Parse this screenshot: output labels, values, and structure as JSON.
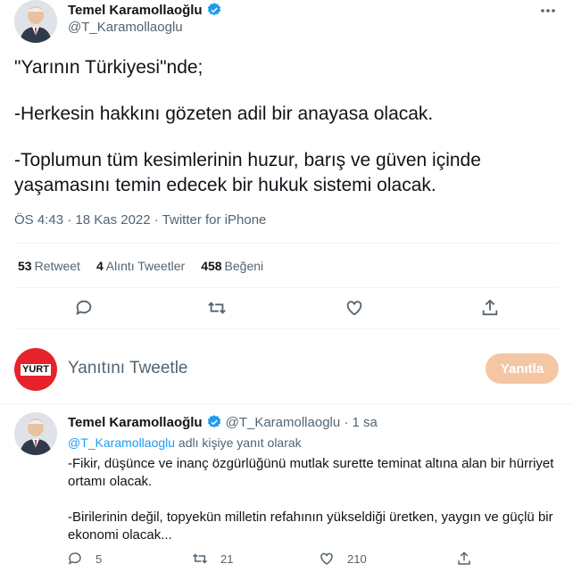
{
  "tweet": {
    "author_name": "Temel Karamollaoğlu",
    "author_handle": "@T_Karamollaoglu",
    "lines": [
      "\"Yarının Türkiyesi\"nde;",
      "-Herkesin hakkını gözeten adil bir anayasa olacak.",
      "-Toplumun tüm kesimlerinin huzur, barış ve güven içinde yaşamasını temin edecek bir hukuk sistemi olacak."
    ],
    "meta": "ÖS 4:43 · 18 Kas 2022 · Twitter for iPhone",
    "stats": {
      "retweets_count": "53",
      "retweets_label": "Retweet",
      "quotes_count": "4",
      "quotes_label": "Alıntı Tweetler",
      "likes_count": "458",
      "likes_label": "Beğeni"
    },
    "icons": [
      "reply-icon",
      "retweet-icon",
      "like-icon",
      "share-icon"
    ]
  },
  "composer": {
    "avatar_text": "YURT",
    "placeholder": "Yanıtını Tweetle",
    "button_label": "Yanıtla"
  },
  "reply": {
    "author_name": "Temel Karamollaoğlu",
    "handle_time": "@T_Karamollaoglu · 1 sa",
    "mention": "@T_Karamollaoglu",
    "reply_to_suffix": " adlı kişiye yanıt olarak",
    "paragraphs": [
      "-Fikir, düşünce ve inanç özgürlüğünü mutlak surette teminat altına alan bir hürriyet ortamı olacak.",
      "-Birilerinin değil, topyekün milletin refahının yükseldiği üretken, yaygın ve güçlü bir ekonomi olacak..."
    ],
    "actions": {
      "replies": "5",
      "retweets": "21",
      "likes": "210"
    }
  },
  "colors": {
    "accent": "#1d9bf0",
    "reply_button": "#f4c6a4",
    "muted": "#536471"
  }
}
